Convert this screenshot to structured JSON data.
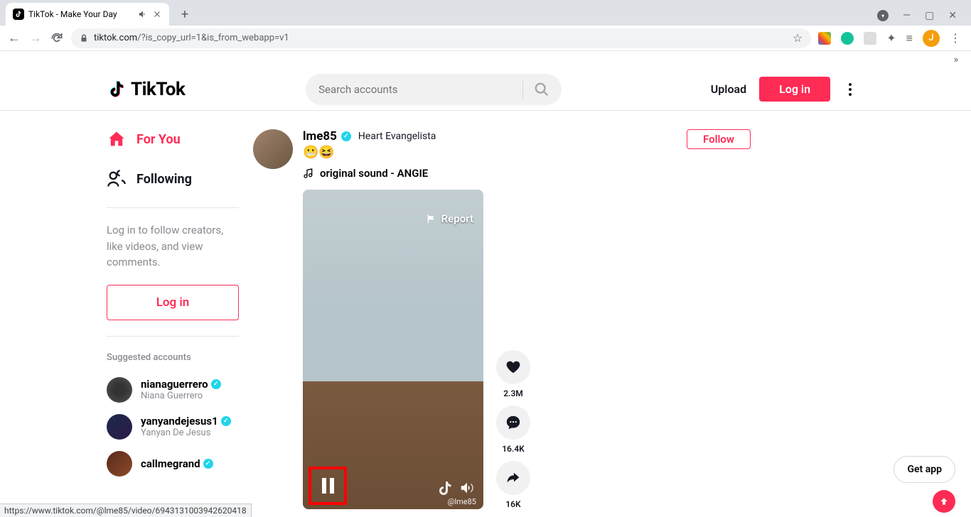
{
  "browser": {
    "tab_title": "TikTok - Make Your Day",
    "url_domain": "tiktok.com",
    "url_path": "/?is_copy_url=1&is_from_webapp=v1",
    "profile_initial": "J",
    "status_bar": "https://www.tiktok.com/@lme85/video/6943131003942620418"
  },
  "header": {
    "logo_text": "TikTok",
    "search_placeholder": "Search accounts",
    "upload_label": "Upload",
    "login_label": "Log in"
  },
  "sidebar": {
    "nav": [
      {
        "label": "For You",
        "active": true
      },
      {
        "label": "Following",
        "active": false
      }
    ],
    "login_prompt": "Log in to follow creators, like videos, and view comments.",
    "login_button": "Log in",
    "suggested_title": "Suggested accounts",
    "suggested": [
      {
        "username": "nianaguerrero",
        "display": "Niana Guerrero",
        "verified": true
      },
      {
        "username": "yanyandejesus1",
        "display": "Yanyan De Jesus",
        "verified": true
      },
      {
        "username": "callmegrand",
        "display": "",
        "verified": true
      }
    ]
  },
  "post": {
    "username": "lme85",
    "display_name": "Heart Evangelista",
    "verified": true,
    "caption": "😬😆",
    "sound": "original sound - ANGIE",
    "follow_label": "Follow",
    "report_label": "Report",
    "watermark_user": "@lme85",
    "actions": {
      "likes": "2.3M",
      "comments": "16.4K",
      "shares": "16K"
    }
  },
  "floating": {
    "get_app": "Get app"
  }
}
